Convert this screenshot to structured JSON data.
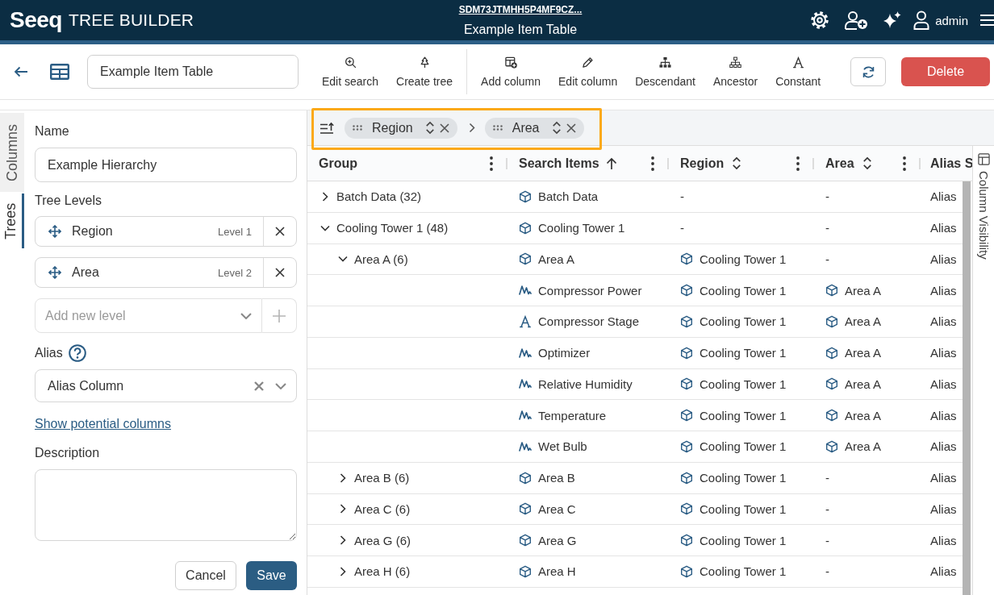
{
  "header": {
    "logo": "Seeq",
    "app_title": "TREE BUILDER",
    "item_id": "SDM73JTMHH5P4MF9CZ...",
    "item_title": "Example Item Table",
    "user": "admin"
  },
  "toolbar": {
    "table_name": "Example Item Table",
    "tool_groups": [
      [
        {
          "label": "Edit search",
          "kind": "search"
        },
        {
          "label": "Create tree",
          "kind": "tree"
        }
      ],
      [
        {
          "label": "Add column",
          "kind": "add-column"
        },
        {
          "label": "Edit column",
          "kind": "edit"
        },
        {
          "label": "Descendant",
          "kind": "descendant"
        },
        {
          "label": "Ancestor",
          "kind": "ancestor"
        },
        {
          "label": "Constant",
          "kind": "constant"
        }
      ]
    ],
    "delete_label": "Delete"
  },
  "side_tabs": [
    {
      "label": "Columns",
      "selected": false
    },
    {
      "label": "Trees",
      "selected": true
    }
  ],
  "tree_form": {
    "name_label": "Name",
    "name_value": "Example Hierarchy",
    "levels_label": "Tree Levels",
    "levels": [
      {
        "name": "Region",
        "level": "Level 1"
      },
      {
        "name": "Area",
        "level": "Level 2"
      }
    ],
    "add_level": {
      "placeholder": "Add new level",
      "disabled": true
    },
    "alias_label": "Alias",
    "alias_value": "Alias Column",
    "link": "Show potential columns",
    "description_label": "Description",
    "cancel_label": "Cancel",
    "save_label": "Save"
  },
  "grouping_bar": {
    "highlighted": true,
    "chips": [
      {
        "label": "Region"
      },
      {
        "label": "Area"
      }
    ]
  },
  "table": {
    "columns": [
      {
        "label": "Group",
        "sortable": false,
        "sorted": false,
        "menu": true
      },
      {
        "label": "Search Items",
        "sortable": true,
        "sorted": true,
        "menu": true
      },
      {
        "label": "Region",
        "sortable": true,
        "sorted": false,
        "menu": true
      },
      {
        "label": "Area",
        "sortable": true,
        "sorted": false,
        "menu": true
      },
      {
        "label": "Alias S"
      }
    ],
    "rows": [
      {
        "expanded": false,
        "cells": [
          {
            "text": "Batch Data (32)",
            "kind": "plain"
          },
          {
            "text": "Batch Data",
            "kind": "asset"
          },
          {
            "text": "-",
            "kind": "plain"
          },
          {
            "text": "-",
            "kind": "plain"
          },
          {
            "text": "Alias",
            "kind": "plain"
          }
        ]
      },
      {
        "expanded": true,
        "cells": [
          {
            "text": "Cooling Tower 1 (48)",
            "kind": "plain"
          },
          {
            "text": "Cooling Tower 1",
            "kind": "asset"
          },
          {
            "text": "-",
            "kind": "plain"
          },
          {
            "text": "-",
            "kind": "plain"
          },
          {
            "text": "Alias",
            "kind": "plain"
          }
        ],
        "children": [
          {
            "expanded": true,
            "cells": [
              {
                "text": "Area A (6)",
                "kind": "plain"
              },
              {
                "text": "Area A",
                "kind": "asset"
              },
              {
                "text": "Cooling Tower 1",
                "kind": "asset"
              },
              {
                "text": "-",
                "kind": "plain"
              },
              {
                "text": "Alias",
                "kind": "plain"
              }
            ],
            "children": [
              {
                "cells": [
                  {
                    "text": "",
                    "kind": "plain"
                  },
                  {
                    "text": "Compressor Power",
                    "kind": "signal"
                  },
                  {
                    "text": "Cooling Tower 1",
                    "kind": "asset"
                  },
                  {
                    "text": "Area A",
                    "kind": "asset"
                  },
                  {
                    "text": "Alias",
                    "kind": "plain"
                  }
                ]
              },
              {
                "cells": [
                  {
                    "text": "",
                    "kind": "plain"
                  },
                  {
                    "text": "Compressor Stage",
                    "kind": "string"
                  },
                  {
                    "text": "Cooling Tower 1",
                    "kind": "asset"
                  },
                  {
                    "text": "Area A",
                    "kind": "asset"
                  },
                  {
                    "text": "Alias",
                    "kind": "plain"
                  }
                ]
              },
              {
                "cells": [
                  {
                    "text": "",
                    "kind": "plain"
                  },
                  {
                    "text": "Optimizer",
                    "kind": "signal"
                  },
                  {
                    "text": "Cooling Tower 1",
                    "kind": "asset"
                  },
                  {
                    "text": "Area A",
                    "kind": "asset"
                  },
                  {
                    "text": "Alias",
                    "kind": "plain"
                  }
                ]
              },
              {
                "cells": [
                  {
                    "text": "",
                    "kind": "plain"
                  },
                  {
                    "text": "Relative Humidity",
                    "kind": "signal"
                  },
                  {
                    "text": "Cooling Tower 1",
                    "kind": "asset"
                  },
                  {
                    "text": "Area A",
                    "kind": "asset"
                  },
                  {
                    "text": "Alias",
                    "kind": "plain"
                  }
                ]
              },
              {
                "cells": [
                  {
                    "text": "",
                    "kind": "plain"
                  },
                  {
                    "text": "Temperature",
                    "kind": "signal"
                  },
                  {
                    "text": "Cooling Tower 1",
                    "kind": "asset"
                  },
                  {
                    "text": "Area A",
                    "kind": "asset"
                  },
                  {
                    "text": "Alias",
                    "kind": "plain"
                  }
                ]
              },
              {
                "cells": [
                  {
                    "text": "",
                    "kind": "plain"
                  },
                  {
                    "text": "Wet Bulb",
                    "kind": "signal"
                  },
                  {
                    "text": "Cooling Tower 1",
                    "kind": "asset"
                  },
                  {
                    "text": "Area A",
                    "kind": "asset"
                  },
                  {
                    "text": "Alias",
                    "kind": "plain"
                  }
                ]
              }
            ]
          },
          {
            "expanded": false,
            "cells": [
              {
                "text": "Area B (6)",
                "kind": "plain"
              },
              {
                "text": "Area B",
                "kind": "asset"
              },
              {
                "text": "Cooling Tower 1",
                "kind": "asset"
              },
              {
                "text": "-",
                "kind": "plain"
              },
              {
                "text": "Alias",
                "kind": "plain"
              }
            ]
          },
          {
            "expanded": false,
            "cells": [
              {
                "text": "Area C (6)",
                "kind": "plain"
              },
              {
                "text": "Area C",
                "kind": "asset"
              },
              {
                "text": "Cooling Tower 1",
                "kind": "asset"
              },
              {
                "text": "-",
                "kind": "plain"
              },
              {
                "text": "Alias",
                "kind": "plain"
              }
            ]
          },
          {
            "expanded": false,
            "cells": [
              {
                "text": "Area G (6)",
                "kind": "plain"
              },
              {
                "text": "Area G",
                "kind": "asset"
              },
              {
                "text": "Cooling Tower 1",
                "kind": "asset"
              },
              {
                "text": "-",
                "kind": "plain"
              },
              {
                "text": "Alias",
                "kind": "plain"
              }
            ]
          },
          {
            "expanded": false,
            "cells": [
              {
                "text": "Area H (6)",
                "kind": "plain"
              },
              {
                "text": "Area H",
                "kind": "asset"
              },
              {
                "text": "Cooling Tower 1",
                "kind": "asset"
              },
              {
                "text": "-",
                "kind": "plain"
              },
              {
                "text": "Alias",
                "kind": "plain"
              }
            ]
          }
        ]
      }
    ]
  },
  "column_visibility": {
    "label": "Column Visibility"
  }
}
